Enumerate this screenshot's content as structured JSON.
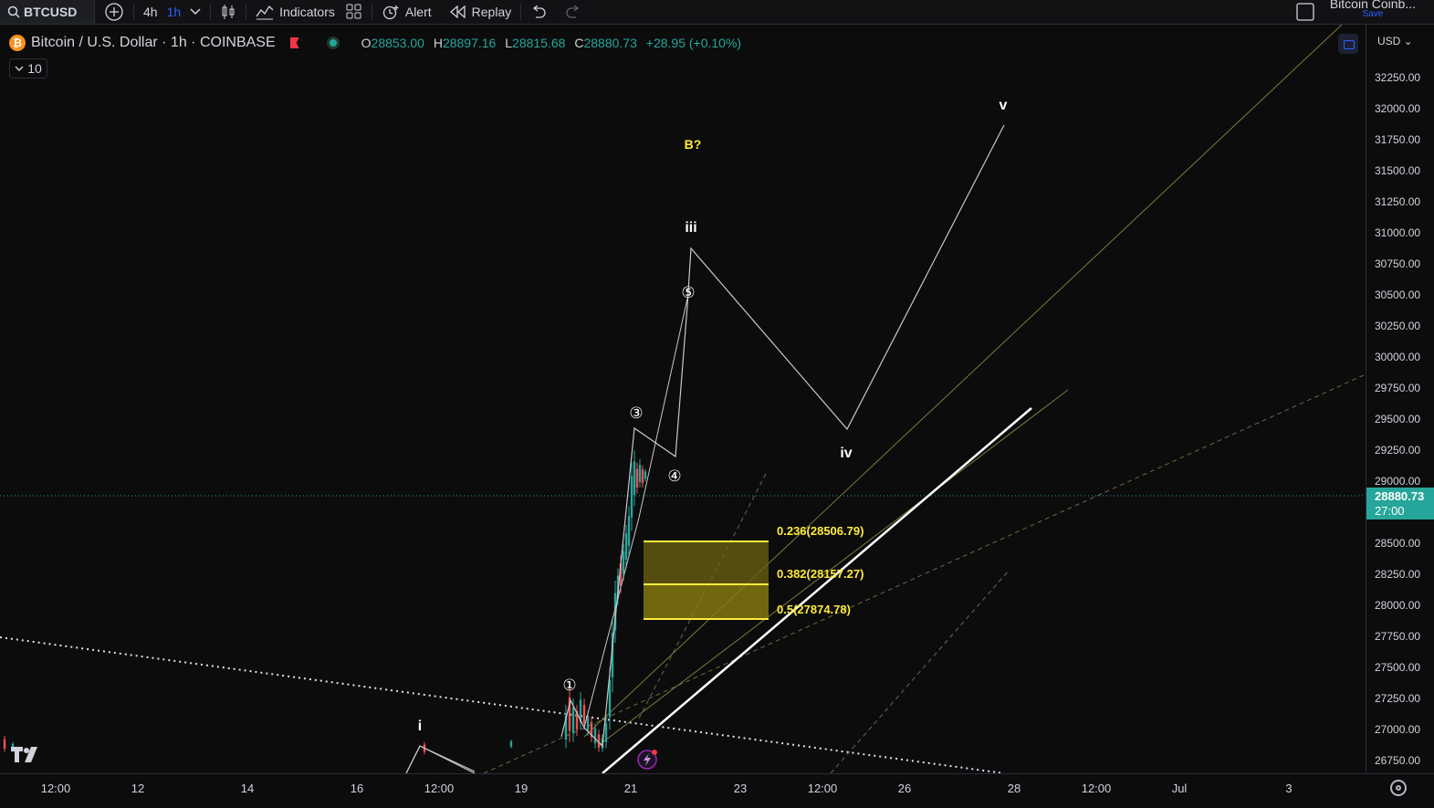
{
  "toolbar": {
    "symbol": "BTCUSD",
    "interval_4h": "4h",
    "interval_1h": "1h",
    "indicators_label": "Indicators",
    "alert_label": "Alert",
    "replay_label": "Replay",
    "layout_name": "Bitcoin Coinb...",
    "save_label": "Save"
  },
  "legend": {
    "coin_glyph": "₿",
    "title": "Bitcoin / U.S. Dollar · 1h · COINBASE",
    "open_key": "O",
    "open": "28853.00",
    "high_key": "H",
    "high": "28897.16",
    "low_key": "L",
    "low": "28815.68",
    "close_key": "C",
    "close": "28880.73",
    "change": "+28.95 (+0.10%)",
    "indicator_count": "10"
  },
  "price_axis": {
    "currency": "USD",
    "labels": [
      "32250.00",
      "32000.00",
      "31750.00",
      "31500.00",
      "31250.00",
      "31000.00",
      "30750.00",
      "30500.00",
      "30250.00",
      "30000.00",
      "29750.00",
      "29500.00",
      "29250.00",
      "29000.00",
      "28500.00",
      "28250.00",
      "28000.00",
      "27750.00",
      "27500.00",
      "27250.00",
      "27000.00",
      "26750.00"
    ],
    "last_price": "28880.73",
    "countdown": "27:00"
  },
  "time_axis": {
    "labels": [
      "12:00",
      "12",
      "14",
      "16",
      "12:00",
      "19",
      "21",
      "23",
      "12:00",
      "26",
      "28",
      "12:00",
      "Jul",
      "3"
    ]
  },
  "chart": {
    "wave_labels": {
      "i": "i",
      "iii": "iii",
      "iv": "iv",
      "v": "v",
      "b": "B?",
      "c1": "①",
      "c3": "③",
      "c4": "④",
      "c5": "⑤"
    },
    "fib_levels": [
      {
        "label": "0.236(28506.79)",
        "price": 28506.79
      },
      {
        "label": "0.382(28157.27)",
        "price": 28157.27
      },
      {
        "label": "0.5(27874.78)",
        "price": 27874.78
      }
    ],
    "colors": {
      "background": "#0c0c0d",
      "up": "#26a69a",
      "down": "#ef5350",
      "fib": "#ffeb3b",
      "accent": "#2962ff"
    }
  },
  "chart_data": {
    "type": "candlestick",
    "symbol": "BTCUSD",
    "exchange": "COINBASE",
    "interval": "1h",
    "last": 28880.73,
    "ylim": [
      26600,
      32400
    ]
  }
}
